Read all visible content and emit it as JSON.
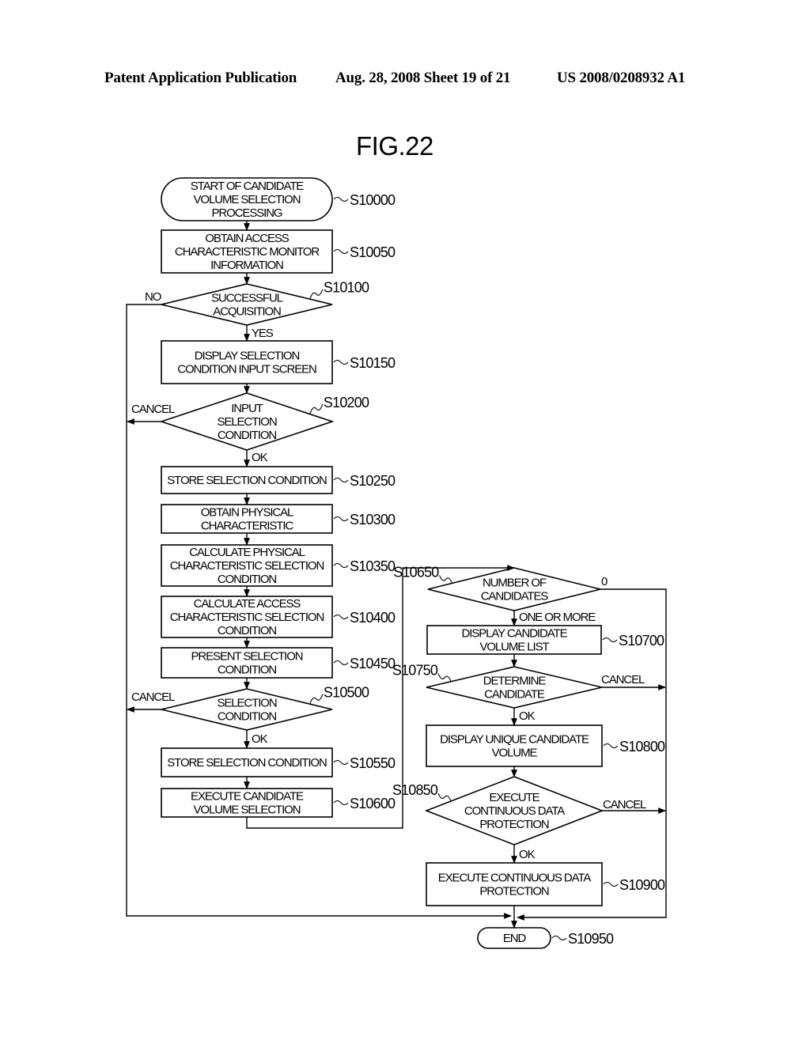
{
  "header": {
    "publication": "Patent Application Publication",
    "date_sheet": "Aug. 28, 2008  Sheet 19 of 21",
    "patent_number": "US 2008/0208932 A1"
  },
  "figure": {
    "title": "FIG.22"
  },
  "flowchart": {
    "nodes": [
      {
        "id": "S10000",
        "type": "terminal",
        "lines": [
          "START OF CANDIDATE",
          "VOLUME SELECTION",
          "PROCESSING"
        ]
      },
      {
        "id": "S10050",
        "type": "process",
        "lines": [
          "OBTAIN ACCESS",
          "CHARACTERISTIC MONITOR",
          "INFORMATION"
        ]
      },
      {
        "id": "S10100",
        "type": "decision",
        "lines": [
          "SUCCESSFUL",
          "ACQUISITION"
        ]
      },
      {
        "id": "S10150",
        "type": "process",
        "lines": [
          "DISPLAY SELECTION",
          "CONDITION INPUT SCREEN"
        ]
      },
      {
        "id": "S10200",
        "type": "decision",
        "lines": [
          "INPUT",
          "SELECTION",
          "CONDITION"
        ]
      },
      {
        "id": "S10250",
        "type": "process",
        "lines": [
          "STORE SELECTION CONDITION"
        ]
      },
      {
        "id": "S10300",
        "type": "process",
        "lines": [
          "OBTAIN PHYSICAL",
          "CHARACTERISTIC"
        ]
      },
      {
        "id": "S10350",
        "type": "process",
        "lines": [
          "CALCULATE PHYSICAL",
          "CHARACTERISTIC SELECTION",
          "CONDITION"
        ]
      },
      {
        "id": "S10400",
        "type": "process",
        "lines": [
          "CALCULATE ACCESS",
          "CHARACTERISTIC SELECTION",
          "CONDITION"
        ]
      },
      {
        "id": "S10450",
        "type": "process",
        "lines": [
          "PRESENT SELECTION",
          "CONDITION"
        ]
      },
      {
        "id": "S10500",
        "type": "decision",
        "lines": [
          "SELECTION",
          "CONDITION"
        ]
      },
      {
        "id": "S10550",
        "type": "process",
        "lines": [
          "STORE SELECTION CONDITION"
        ]
      },
      {
        "id": "S10600",
        "type": "process",
        "lines": [
          "EXECUTE CANDIDATE",
          "VOLUME SELECTION"
        ]
      },
      {
        "id": "S10650",
        "type": "decision",
        "lines": [
          "NUMBER OF",
          "CANDIDATES"
        ]
      },
      {
        "id": "S10700",
        "type": "process",
        "lines": [
          "DISPLAY CANDIDATE",
          "VOLUME LIST"
        ]
      },
      {
        "id": "S10750",
        "type": "decision",
        "lines": [
          "DETERMINE",
          "CANDIDATE"
        ]
      },
      {
        "id": "S10800",
        "type": "process",
        "lines": [
          "DISPLAY UNIQUE CANDIDATE",
          "VOLUME"
        ]
      },
      {
        "id": "S10850",
        "type": "decision",
        "lines": [
          "EXECUTE",
          "CONTINUOUS DATA",
          "PROTECTION"
        ]
      },
      {
        "id": "S10900",
        "type": "process",
        "lines": [
          "EXECUTE CONTINUOUS DATA",
          "PROTECTION"
        ]
      },
      {
        "id": "S10950",
        "type": "terminal",
        "lines": [
          "END"
        ]
      }
    ],
    "edge_labels": {
      "s10100_no": "NO",
      "s10100_yes": "YES",
      "s10200_cancel": "CANCEL",
      "s10200_ok": "OK",
      "s10500_cancel": "CANCEL",
      "s10500_ok": "OK",
      "s10650_zero": "0",
      "s10650_one_or_more": "ONE OR MORE",
      "s10750_cancel": "CANCEL",
      "s10750_ok": "OK",
      "s10850_cancel": "CANCEL",
      "s10850_ok": "OK"
    }
  }
}
